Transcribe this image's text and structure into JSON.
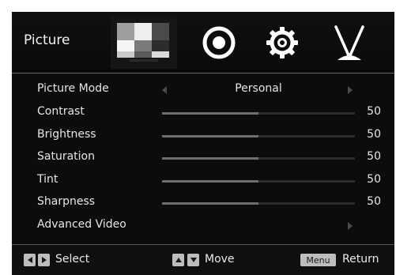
{
  "header": {
    "title": "Picture",
    "tabs": [
      {
        "name": "picture-tab",
        "icon": "picture-icon",
        "active": true
      },
      {
        "name": "sound-tab",
        "icon": "speaker-icon",
        "active": false
      },
      {
        "name": "settings-tab",
        "icon": "gear-icon",
        "active": false
      },
      {
        "name": "channel-tab",
        "icon": "antenna-icon",
        "active": false
      }
    ]
  },
  "menu": {
    "picture_mode": {
      "label": "Picture Mode",
      "value": "Personal"
    },
    "sliders": [
      {
        "label": "Contrast",
        "value": "50",
        "level": 0.5
      },
      {
        "label": "Brightness",
        "value": "50",
        "level": 0.5
      },
      {
        "label": "Saturation",
        "value": "50",
        "level": 0.5
      },
      {
        "label": "Tint",
        "value": "50",
        "level": 0.5
      },
      {
        "label": "Sharpness",
        "value": "50",
        "level": 0.5
      }
    ],
    "advanced": {
      "label": "Advanced Video"
    }
  },
  "footer": {
    "select_label": "Select",
    "move_label": "Move",
    "menu_key": "Menu",
    "return_label": "Return"
  },
  "colors": {
    "background": "#0c0c0c",
    "text": "#e6e6e6",
    "slider_fill": "#6e6e6e",
    "key": "#bdbdbd"
  }
}
